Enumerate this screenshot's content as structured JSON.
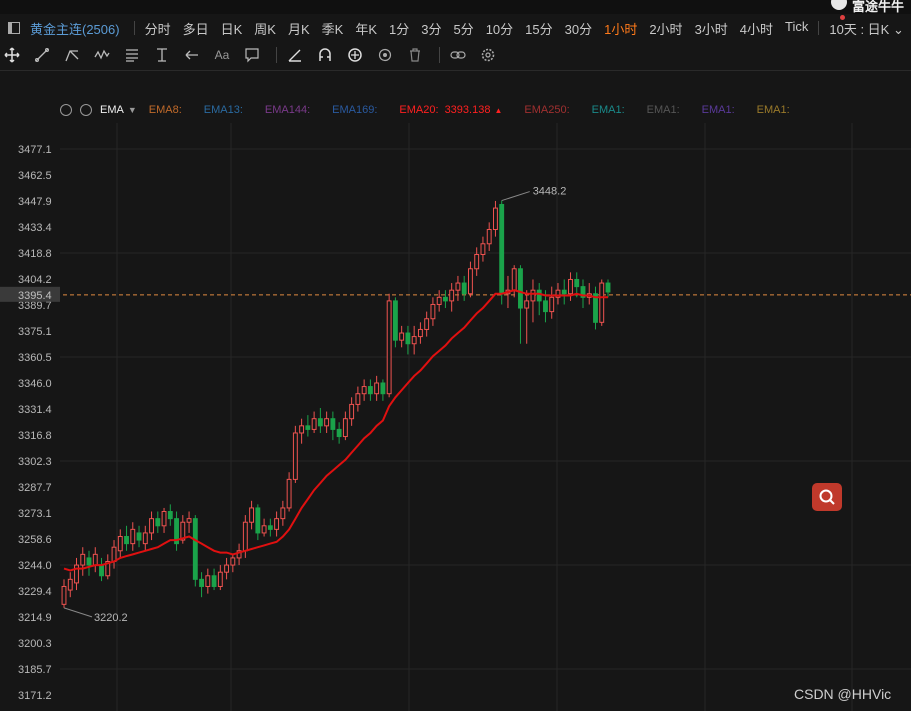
{
  "topbar": {
    "brand": "富途牛牛"
  },
  "symbol": "黄金主连(2506)",
  "periods": [
    {
      "label": "分时",
      "active": false
    },
    {
      "label": "多日",
      "active": false
    },
    {
      "label": "日K",
      "active": false
    },
    {
      "label": "周K",
      "active": false
    },
    {
      "label": "月K",
      "active": false
    },
    {
      "label": "季K",
      "active": false
    },
    {
      "label": "年K",
      "active": false
    },
    {
      "label": "1分",
      "active": false
    },
    {
      "label": "3分",
      "active": false
    },
    {
      "label": "5分",
      "active": false
    },
    {
      "label": "10分",
      "active": false
    },
    {
      "label": "15分",
      "active": false
    },
    {
      "label": "30分",
      "active": false
    },
    {
      "label": "1小时",
      "active": true
    },
    {
      "label": "2小时",
      "active": false
    },
    {
      "label": "3小时",
      "active": false
    },
    {
      "label": "4小时",
      "active": false
    },
    {
      "label": "Tick",
      "active": false
    }
  ],
  "range_select": "10天 : 日K",
  "tools": [
    "crosshair-icon",
    "line-tool-icon",
    "trend-tool-icon",
    "wave-tool-icon",
    "fib-tool-icon",
    "measure-tool-icon",
    "arrow-tool-icon",
    "text-tool-icon",
    "note-tool-icon",
    "angle-tool-icon",
    "magnet-icon",
    "lock-icon",
    "eye-icon",
    "trash-icon",
    "link-icon",
    "settings-icon"
  ],
  "text_tool_label": "Aa",
  "indicator": {
    "name": "EMA",
    "items": [
      {
        "label": "EMA8:",
        "value": "",
        "color": "#c06a2a"
      },
      {
        "label": "EMA13:",
        "value": "",
        "color": "#2a6aa0"
      },
      {
        "label": "EMA144:",
        "value": "",
        "color": "#7a3a8a"
      },
      {
        "label": "EMA169:",
        "value": "",
        "color": "#2a5aa0"
      },
      {
        "label": "EMA20:",
        "value": "3393.138",
        "color": "#ff2020",
        "arrow": "▲"
      },
      {
        "label": "EMA250:",
        "value": "",
        "color": "#a03030"
      },
      {
        "label": "EMA1:",
        "value": "",
        "color": "#1a8a8a"
      },
      {
        "label": "EMA1:",
        "value": "",
        "color": "#555555"
      },
      {
        "label": "EMA1:",
        "value": "",
        "color": "#5a3a9a"
      },
      {
        "label": "EMA1:",
        "value": "",
        "color": "#9a7a2a"
      }
    ]
  },
  "price_labels": [
    "3477.1",
    "3462.5",
    "3447.9",
    "3433.4",
    "3418.8",
    "3404.2",
    "3389.7",
    "3375.1",
    "3360.5",
    "3346.0",
    "3331.4",
    "3316.8",
    "3302.3",
    "3287.7",
    "3273.1",
    "3258.6",
    "3244.0",
    "3229.4",
    "3214.9",
    "3200.3",
    "3185.7",
    "3171.2"
  ],
  "current_price": "3395.4",
  "high_label": "3448.2",
  "low_label": "3220.2",
  "watermark": "CSDN @HHVic",
  "colors": {
    "up": "#ef5350",
    "down": "#1aa34a",
    "ema": "#e01010",
    "current": "#e08a40"
  },
  "chart_data": {
    "type": "candlestick",
    "ylim": [
      3171.2,
      3477.1
    ],
    "current_price": 3395.4,
    "candles": [
      {
        "o": 3222,
        "c": 3232,
        "h": 3236,
        "l": 3220
      },
      {
        "o": 3230,
        "c": 3236,
        "h": 3240,
        "l": 3226
      },
      {
        "o": 3234,
        "c": 3244,
        "h": 3248,
        "l": 3230
      },
      {
        "o": 3244,
        "c": 3250,
        "h": 3254,
        "l": 3238
      },
      {
        "o": 3248,
        "c": 3244,
        "h": 3252,
        "l": 3238
      },
      {
        "o": 3244,
        "c": 3250,
        "h": 3254,
        "l": 3240
      },
      {
        "o": 3244,
        "c": 3238,
        "h": 3248,
        "l": 3235
      },
      {
        "o": 3238,
        "c": 3246,
        "h": 3250,
        "l": 3236
      },
      {
        "o": 3246,
        "c": 3254,
        "h": 3258,
        "l": 3242
      },
      {
        "o": 3252,
        "c": 3260,
        "h": 3264,
        "l": 3248
      },
      {
        "o": 3260,
        "c": 3256,
        "h": 3266,
        "l": 3252
      },
      {
        "o": 3256,
        "c": 3264,
        "h": 3268,
        "l": 3252
      },
      {
        "o": 3262,
        "c": 3258,
        "h": 3266,
        "l": 3254
      },
      {
        "o": 3256,
        "c": 3262,
        "h": 3266,
        "l": 3252
      },
      {
        "o": 3262,
        "c": 3270,
        "h": 3274,
        "l": 3258
      },
      {
        "o": 3270,
        "c": 3266,
        "h": 3274,
        "l": 3262
      },
      {
        "o": 3266,
        "c": 3274,
        "h": 3276,
        "l": 3262
      },
      {
        "o": 3274,
        "c": 3270,
        "h": 3278,
        "l": 3266
      },
      {
        "o": 3270,
        "c": 3256,
        "h": 3274,
        "l": 3252
      },
      {
        "o": 3258,
        "c": 3268,
        "h": 3272,
        "l": 3256
      },
      {
        "o": 3268,
        "c": 3270,
        "h": 3274,
        "l": 3262
      },
      {
        "o": 3270,
        "c": 3236,
        "h": 3272,
        "l": 3232
      },
      {
        "o": 3236,
        "c": 3232,
        "h": 3240,
        "l": 3226
      },
      {
        "o": 3232,
        "c": 3238,
        "h": 3242,
        "l": 3228
      },
      {
        "o": 3238,
        "c": 3232,
        "h": 3242,
        "l": 3230
      },
      {
        "o": 3232,
        "c": 3240,
        "h": 3244,
        "l": 3230
      },
      {
        "o": 3240,
        "c": 3244,
        "h": 3248,
        "l": 3236
      },
      {
        "o": 3244,
        "c": 3248,
        "h": 3250,
        "l": 3240
      },
      {
        "o": 3248,
        "c": 3252,
        "h": 3256,
        "l": 3244
      },
      {
        "o": 3252,
        "c": 3268,
        "h": 3272,
        "l": 3248
      },
      {
        "o": 3268,
        "c": 3276,
        "h": 3280,
        "l": 3264
      },
      {
        "o": 3276,
        "c": 3262,
        "h": 3278,
        "l": 3258
      },
      {
        "o": 3262,
        "c": 3266,
        "h": 3270,
        "l": 3260
      },
      {
        "o": 3266,
        "c": 3264,
        "h": 3270,
        "l": 3260
      },
      {
        "o": 3264,
        "c": 3270,
        "h": 3274,
        "l": 3260
      },
      {
        "o": 3270,
        "c": 3276,
        "h": 3280,
        "l": 3266
      },
      {
        "o": 3276,
        "c": 3292,
        "h": 3296,
        "l": 3274
      },
      {
        "o": 3292,
        "c": 3318,
        "h": 3322,
        "l": 3290
      },
      {
        "o": 3318,
        "c": 3322,
        "h": 3326,
        "l": 3312
      },
      {
        "o": 3322,
        "c": 3320,
        "h": 3328,
        "l": 3316
      },
      {
        "o": 3320,
        "c": 3326,
        "h": 3330,
        "l": 3318
      },
      {
        "o": 3326,
        "c": 3322,
        "h": 3332,
        "l": 3318
      },
      {
        "o": 3322,
        "c": 3326,
        "h": 3330,
        "l": 3318
      },
      {
        "o": 3326,
        "c": 3320,
        "h": 3330,
        "l": 3314
      },
      {
        "o": 3320,
        "c": 3316,
        "h": 3324,
        "l": 3312
      },
      {
        "o": 3316,
        "c": 3326,
        "h": 3330,
        "l": 3314
      },
      {
        "o": 3326,
        "c": 3334,
        "h": 3338,
        "l": 3322
      },
      {
        "o": 3334,
        "c": 3340,
        "h": 3344,
        "l": 3330
      },
      {
        "o": 3340,
        "c": 3344,
        "h": 3348,
        "l": 3336
      },
      {
        "o": 3344,
        "c": 3340,
        "h": 3348,
        "l": 3336
      },
      {
        "o": 3340,
        "c": 3346,
        "h": 3350,
        "l": 3336
      },
      {
        "o": 3346,
        "c": 3340,
        "h": 3348,
        "l": 3336
      },
      {
        "o": 3340,
        "c": 3392,
        "h": 3396,
        "l": 3338
      },
      {
        "o": 3392,
        "c": 3370,
        "h": 3394,
        "l": 3366
      },
      {
        "o": 3370,
        "c": 3374,
        "h": 3378,
        "l": 3366
      },
      {
        "o": 3374,
        "c": 3368,
        "h": 3378,
        "l": 3362
      },
      {
        "o": 3368,
        "c": 3372,
        "h": 3378,
        "l": 3362
      },
      {
        "o": 3372,
        "c": 3376,
        "h": 3380,
        "l": 3368
      },
      {
        "o": 3376,
        "c": 3382,
        "h": 3386,
        "l": 3372
      },
      {
        "o": 3382,
        "c": 3390,
        "h": 3394,
        "l": 3378
      },
      {
        "o": 3390,
        "c": 3394,
        "h": 3398,
        "l": 3386
      },
      {
        "o": 3394,
        "c": 3392,
        "h": 3398,
        "l": 3388
      },
      {
        "o": 3392,
        "c": 3398,
        "h": 3402,
        "l": 3386
      },
      {
        "o": 3398,
        "c": 3402,
        "h": 3406,
        "l": 3392
      },
      {
        "o": 3402,
        "c": 3396,
        "h": 3406,
        "l": 3392
      },
      {
        "o": 3396,
        "c": 3410,
        "h": 3414,
        "l": 3394
      },
      {
        "o": 3410,
        "c": 3418,
        "h": 3422,
        "l": 3406
      },
      {
        "o": 3418,
        "c": 3424,
        "h": 3428,
        "l": 3414
      },
      {
        "o": 3424,
        "c": 3432,
        "h": 3436,
        "l": 3420
      },
      {
        "o": 3432,
        "c": 3444,
        "h": 3448,
        "l": 3428
      },
      {
        "o": 3446,
        "c": 3396,
        "h": 3448.2,
        "l": 3390
      },
      {
        "o": 3396,
        "c": 3398,
        "h": 3406,
        "l": 3388
      },
      {
        "o": 3398,
        "c": 3410,
        "h": 3412,
        "l": 3394
      },
      {
        "o": 3410,
        "c": 3388,
        "h": 3412,
        "l": 3368
      },
      {
        "o": 3388,
        "c": 3392,
        "h": 3398,
        "l": 3368
      },
      {
        "o": 3392,
        "c": 3398,
        "h": 3404,
        "l": 3380
      },
      {
        "o": 3398,
        "c": 3392,
        "h": 3402,
        "l": 3384
      },
      {
        "o": 3392,
        "c": 3386,
        "h": 3398,
        "l": 3380
      },
      {
        "o": 3386,
        "c": 3394,
        "h": 3400,
        "l": 3382
      },
      {
        "o": 3394,
        "c": 3398,
        "h": 3402,
        "l": 3390
      },
      {
        "o": 3398,
        "c": 3396,
        "h": 3404,
        "l": 3390
      },
      {
        "o": 3396,
        "c": 3404,
        "h": 3408,
        "l": 3392
      },
      {
        "o": 3404,
        "c": 3400,
        "h": 3408,
        "l": 3394
      },
      {
        "o": 3400,
        "c": 3394,
        "h": 3404,
        "l": 3388
      },
      {
        "o": 3394,
        "c": 3396,
        "h": 3402,
        "l": 3390
      },
      {
        "o": 3396,
        "c": 3380,
        "h": 3400,
        "l": 3376
      },
      {
        "o": 3380,
        "c": 3402,
        "h": 3404,
        "l": 3378
      },
      {
        "o": 3402,
        "c": 3397,
        "h": 3404,
        "l": 3394
      }
    ],
    "ema20": [
      3242,
      3241,
      3242,
      3242,
      3243,
      3244,
      3244,
      3245,
      3246,
      3248,
      3249,
      3250,
      3251,
      3252,
      3253,
      3254,
      3256,
      3258,
      3258,
      3259,
      3260,
      3258,
      3256,
      3254,
      3252,
      3251,
      3251,
      3250,
      3251,
      3252,
      3253,
      3254,
      3255,
      3256,
      3257,
      3260,
      3264,
      3270,
      3276,
      3281,
      3286,
      3290,
      3294,
      3297,
      3300,
      3303,
      3307,
      3311,
      3315,
      3318,
      3322,
      3325,
      3333,
      3338,
      3342,
      3346,
      3350,
      3353,
      3357,
      3361,
      3364,
      3367,
      3371,
      3374,
      3377,
      3381,
      3385,
      3388,
      3392,
      3396,
      3396,
      3397,
      3398,
      3397,
      3396,
      3396,
      3396,
      3395,
      3395,
      3395,
      3395,
      3395,
      3396,
      3395,
      3395,
      3394,
      3394,
      3394
    ]
  }
}
